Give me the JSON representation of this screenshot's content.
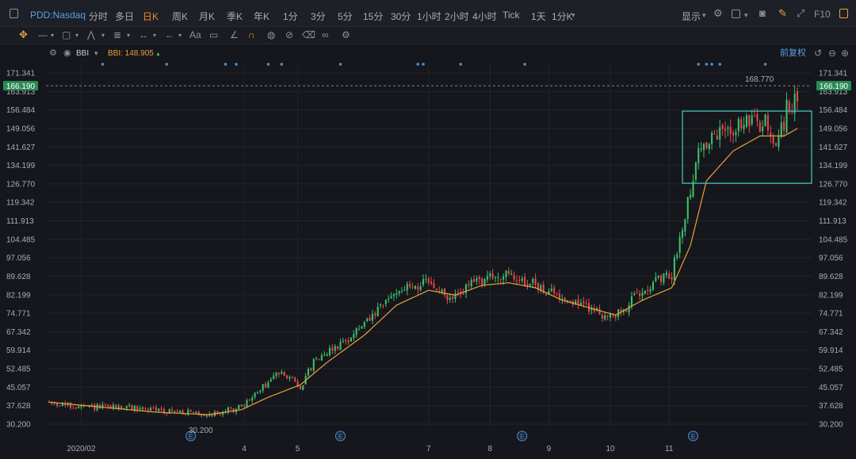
{
  "toolbar": {
    "symbol": "PDD:Nasdaq",
    "periods": [
      "分时",
      "多日",
      "日K",
      "周K",
      "月K",
      "季K",
      "年K",
      "1分",
      "3分",
      "5分",
      "15分",
      "30分",
      "1小时",
      "2小时",
      "4小时",
      "Tick",
      "1天",
      "1分K"
    ],
    "active_period": "日K",
    "display_label": "显示",
    "f10_label": "F10"
  },
  "indicator": {
    "name": "BBI",
    "value_label": "BBI: 148.905",
    "adjust_label": "前复权"
  },
  "colors": {
    "background": "#15171c",
    "up": "#3fbf6b",
    "down": "#e5484d",
    "bbi_line": "#e8a23a",
    "highlight_box": "#3fbfb5",
    "price_tag": "#2c8a55",
    "active_tab": "#ea8a2a",
    "symbol": "#5b9fe6",
    "event_marker": "#4a8fd8"
  },
  "chart_data": {
    "type": "candlestick",
    "y_ticks": [
      "171.341",
      "163.913",
      "156.484",
      "149.056",
      "141.627",
      "134.199",
      "126.770",
      "119.342",
      "111.913",
      "104.485",
      "97.056",
      "89.628",
      "82.199",
      "74.771",
      "67.342",
      "59.914",
      "52.485",
      "45.057",
      "37.628",
      "30.200"
    ],
    "ylim": [
      30.2,
      171.341
    ],
    "x_ticks": [
      {
        "label": "2020/02",
        "t": 12
      },
      {
        "label": "4",
        "t": 73
      },
      {
        "label": "5",
        "t": 93
      },
      {
        "label": "7",
        "t": 142
      },
      {
        "label": "8",
        "t": 165
      },
      {
        "label": "9",
        "t": 187
      },
      {
        "label": "10",
        "t": 210
      },
      {
        "label": "11",
        "t": 232
      }
    ],
    "current_price": "166.190",
    "max_label": "168.770",
    "min_label": "30.200",
    "earnings_marker_label": "E",
    "earnings_t": [
      53,
      109,
      177,
      241
    ],
    "dividend_dots_t": [
      20,
      44,
      66,
      70,
      82,
      87,
      109,
      138,
      140,
      154,
      178,
      243,
      246,
      248,
      251,
      268
    ],
    "highlight_box": {
      "t_start": 237,
      "t_end": 280,
      "y_low": 127,
      "y_high": 156
    },
    "waypoints": [
      [
        0,
        39
      ],
      [
        10,
        37
      ],
      [
        30,
        37
      ],
      [
        50,
        35
      ],
      [
        60,
        34
      ],
      [
        72,
        37
      ],
      [
        80,
        45
      ],
      [
        87,
        52
      ],
      [
        94,
        45
      ],
      [
        100,
        57
      ],
      [
        110,
        63
      ],
      [
        120,
        72
      ],
      [
        130,
        84
      ],
      [
        142,
        87
      ],
      [
        150,
        80
      ],
      [
        160,
        88
      ],
      [
        170,
        90
      ],
      [
        180,
        87
      ],
      [
        190,
        82
      ],
      [
        200,
        78
      ],
      [
        210,
        73
      ],
      [
        215,
        76
      ],
      [
        222,
        85
      ],
      [
        233,
        90
      ],
      [
        238,
        115
      ],
      [
        243,
        140
      ],
      [
        252,
        148
      ],
      [
        263,
        152
      ],
      [
        272,
        145
      ],
      [
        280,
        160
      ]
    ],
    "bbi_waypoints": [
      [
        0,
        39
      ],
      [
        20,
        37
      ],
      [
        40,
        35
      ],
      [
        60,
        34
      ],
      [
        72,
        36
      ],
      [
        82,
        41
      ],
      [
        94,
        46
      ],
      [
        104,
        55
      ],
      [
        118,
        66
      ],
      [
        130,
        78
      ],
      [
        142,
        84
      ],
      [
        152,
        82
      ],
      [
        162,
        86
      ],
      [
        172,
        87
      ],
      [
        182,
        85
      ],
      [
        192,
        80
      ],
      [
        202,
        77
      ],
      [
        212,
        74
      ],
      [
        222,
        80
      ],
      [
        233,
        85
      ],
      [
        240,
        102
      ],
      [
        246,
        128
      ],
      [
        256,
        140
      ],
      [
        266,
        146
      ],
      [
        275,
        146
      ],
      [
        280,
        149
      ]
    ],
    "n_bars": 281
  }
}
